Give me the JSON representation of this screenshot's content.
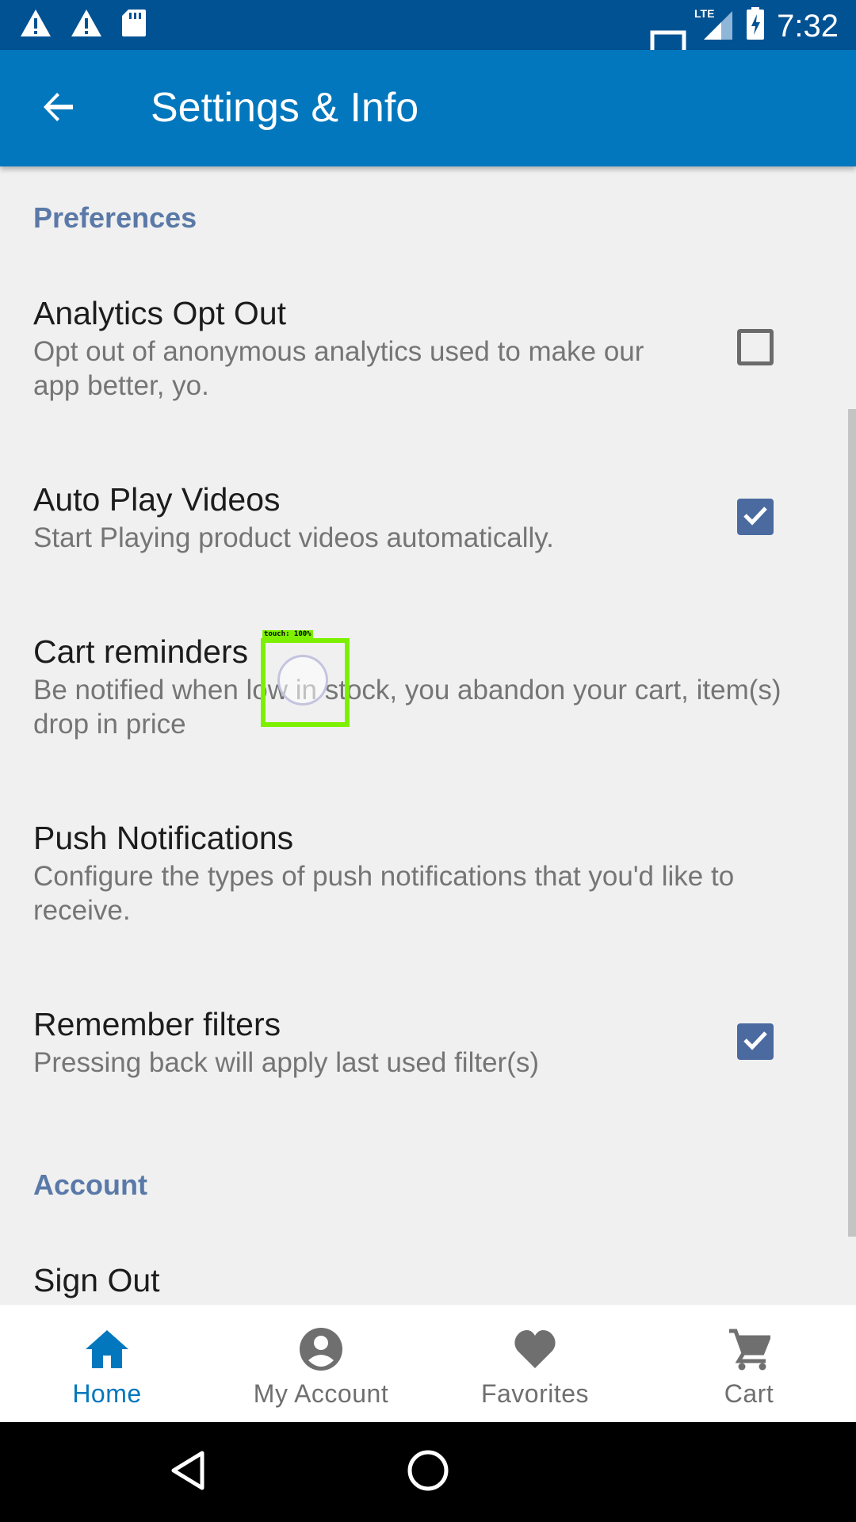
{
  "status_bar": {
    "time": "7:32",
    "network": "LTE",
    "icons": [
      "warning-icon",
      "warning-icon",
      "sd-card-icon",
      "lte-signal-icon",
      "battery-charging-icon"
    ]
  },
  "app_bar": {
    "title": "Settings & Info",
    "back_icon": "arrow-back-icon"
  },
  "sections": {
    "preferences": {
      "header": "Preferences"
    },
    "account": {
      "header": "Account"
    }
  },
  "preferences": {
    "analytics": {
      "title": "Analytics Opt Out",
      "summary": "Opt out of anonymous analytics used to make our app better, yo.",
      "checked": false
    },
    "autoplay": {
      "title": "Auto Play Videos",
      "summary": "Start Playing product videos automatically.",
      "checked": true
    },
    "cart_reminders": {
      "title": "Cart reminders",
      "summary": "Be notified when low in stock, you abandon your cart, item(s) drop in price"
    },
    "push": {
      "title": "Push Notifications",
      "summary": "Configure the types of push notifications that you'd like to receive."
    },
    "filters": {
      "title": "Remember filters",
      "summary": "Pressing back will apply last used filter(s)",
      "checked": true
    }
  },
  "account": {
    "sign_out": {
      "title": "Sign Out"
    }
  },
  "touch_overlay": {
    "label": "touch: 100%"
  },
  "bottom_nav": {
    "items": [
      {
        "label": "Home",
        "icon": "home-icon",
        "active": true
      },
      {
        "label": "My Account",
        "icon": "account-circle-icon",
        "active": false
      },
      {
        "label": "Favorites",
        "icon": "heart-icon",
        "active": false
      },
      {
        "label": "Cart",
        "icon": "cart-icon",
        "active": false
      }
    ]
  },
  "colors": {
    "status_bar": "#015293",
    "app_bar": "#0277bd",
    "accent": "#0277bd",
    "section_header": "#5a79a8",
    "checkbox_checked": "#4a6aa0",
    "background": "#f0f0f0"
  }
}
